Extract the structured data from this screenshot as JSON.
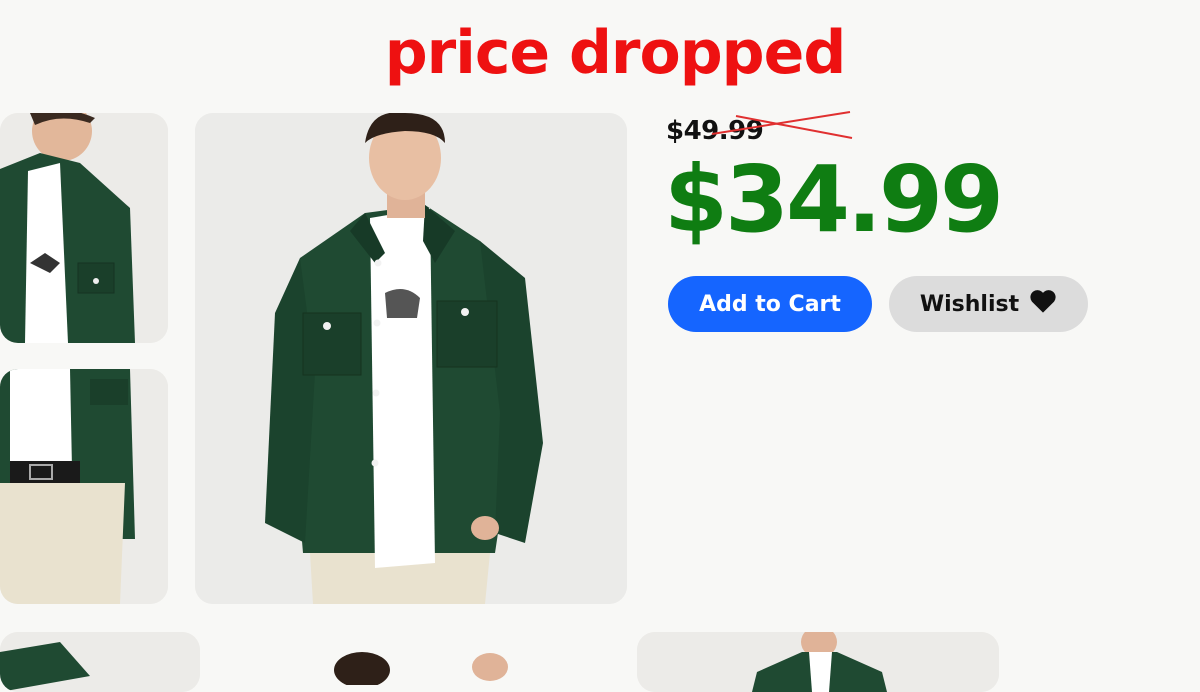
{
  "promo": {
    "headline": "price dropped"
  },
  "product": {
    "original_price": "$49.99",
    "sale_price": "$34.99"
  },
  "actions": {
    "add_to_cart_label": "Add to Cart",
    "wishlist_label": "Wishlist",
    "wishlist_icon": "heart-icon"
  },
  "colors": {
    "headline": "#ee1111",
    "sale_price": "#0f7d12",
    "primary_button": "#1565ff",
    "secondary_button": "#dcdcdc",
    "jacket": "#1f4a32"
  }
}
